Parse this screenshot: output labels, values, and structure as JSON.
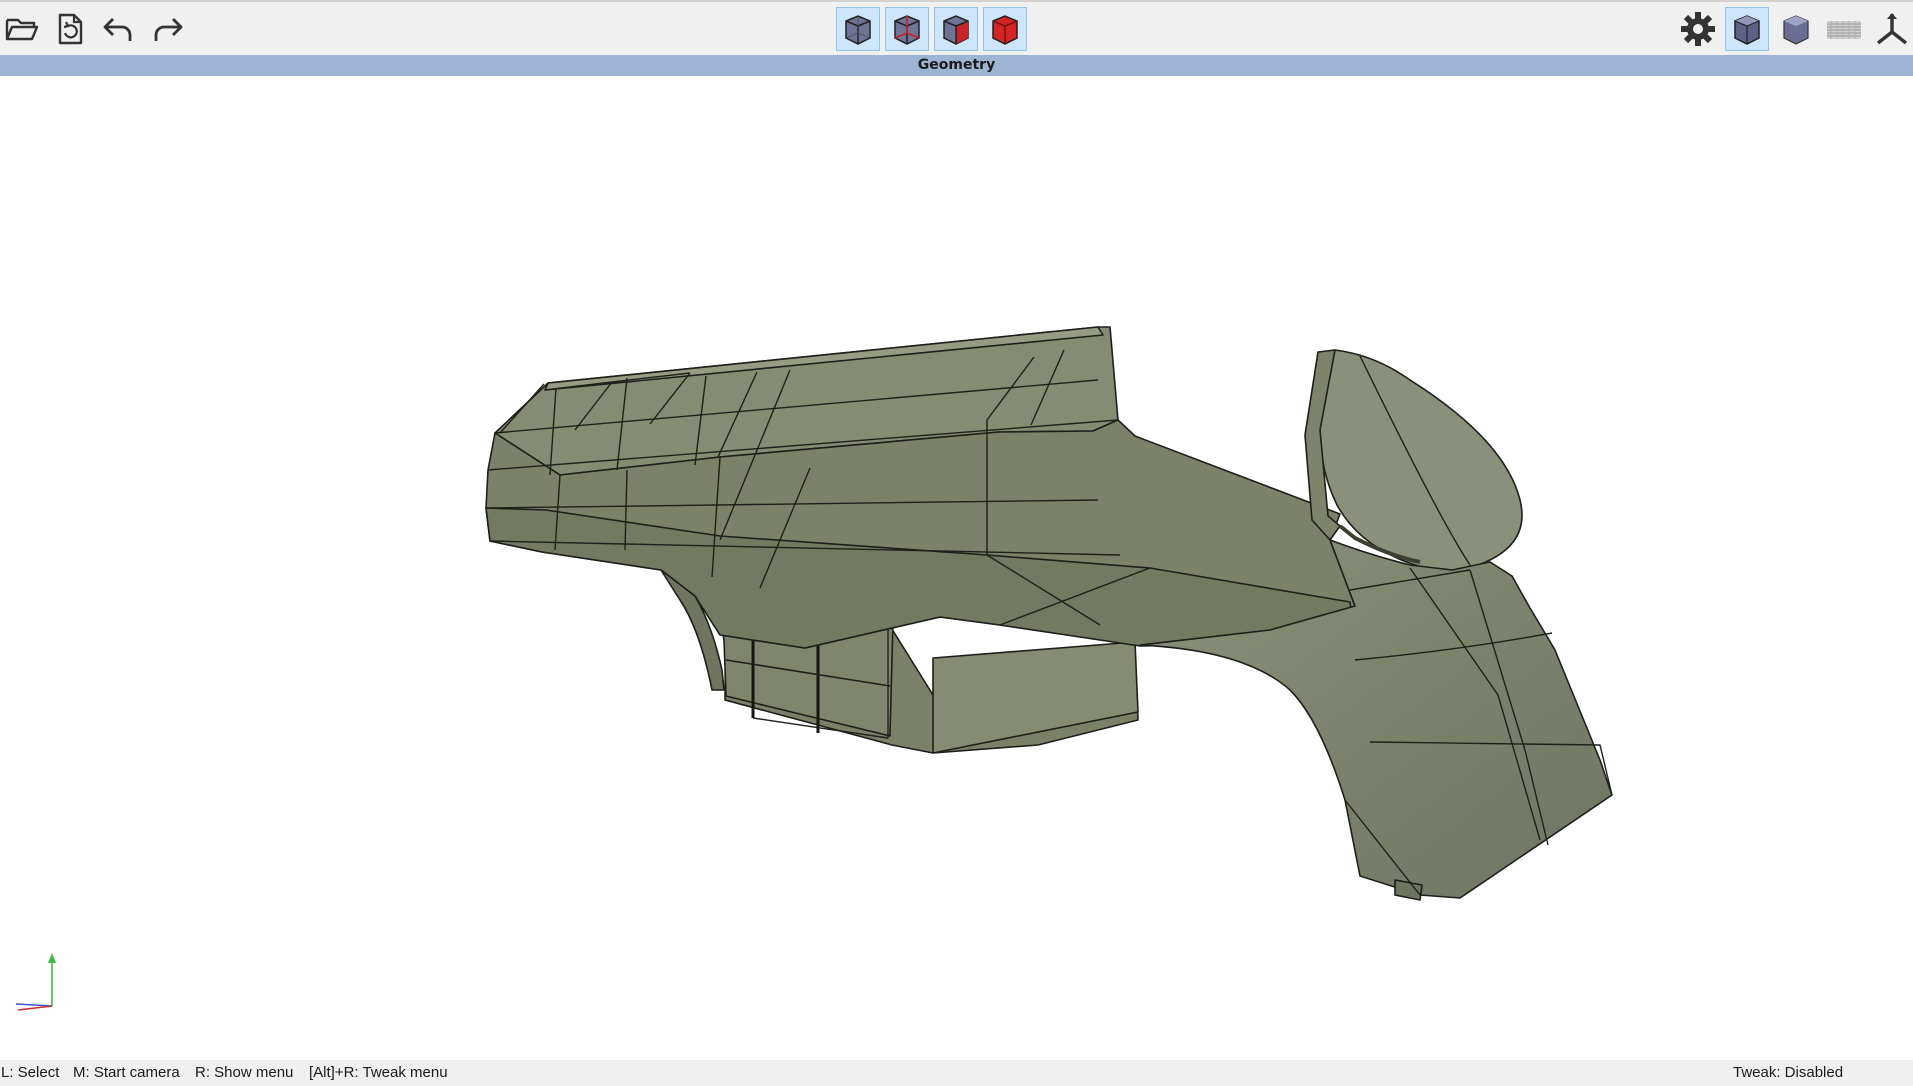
{
  "toolbar": {
    "left_icons": [
      "open-folder-icon",
      "reload-file-icon",
      "undo-icon",
      "redo-icon"
    ],
    "view_modes": [
      {
        "name": "wireframe-cube-icon",
        "active": true
      },
      {
        "name": "wireframe-red-edges-cube-icon",
        "active": true
      },
      {
        "name": "shaded-red-edges-cube-icon",
        "active": true
      },
      {
        "name": "solid-red-cube-icon",
        "active": true
      }
    ],
    "right_icons": [
      {
        "name": "settings-gear-icon",
        "active": false
      },
      {
        "name": "shaded-cube-icon",
        "active": true
      },
      {
        "name": "solid-cube-icon",
        "active": false
      },
      {
        "name": "ground-grid-icon",
        "active": false
      },
      {
        "name": "axes-icon",
        "active": false
      }
    ]
  },
  "panel": {
    "title": "Geometry"
  },
  "colors": {
    "accent": "#9db4d4",
    "model": "#7e8670",
    "active_button": "#cde6fb",
    "axis_y": "#3dbb3d",
    "axis_x": "#d62b2b",
    "axis_z": "#3b53d6"
  },
  "status": {
    "select": "L: Select",
    "camera": "M: Start camera",
    "menu": "R: Show menu",
    "tweak_menu": "[Alt]+R: Tweak menu",
    "tweak_state": "Tweak: Disabled"
  }
}
